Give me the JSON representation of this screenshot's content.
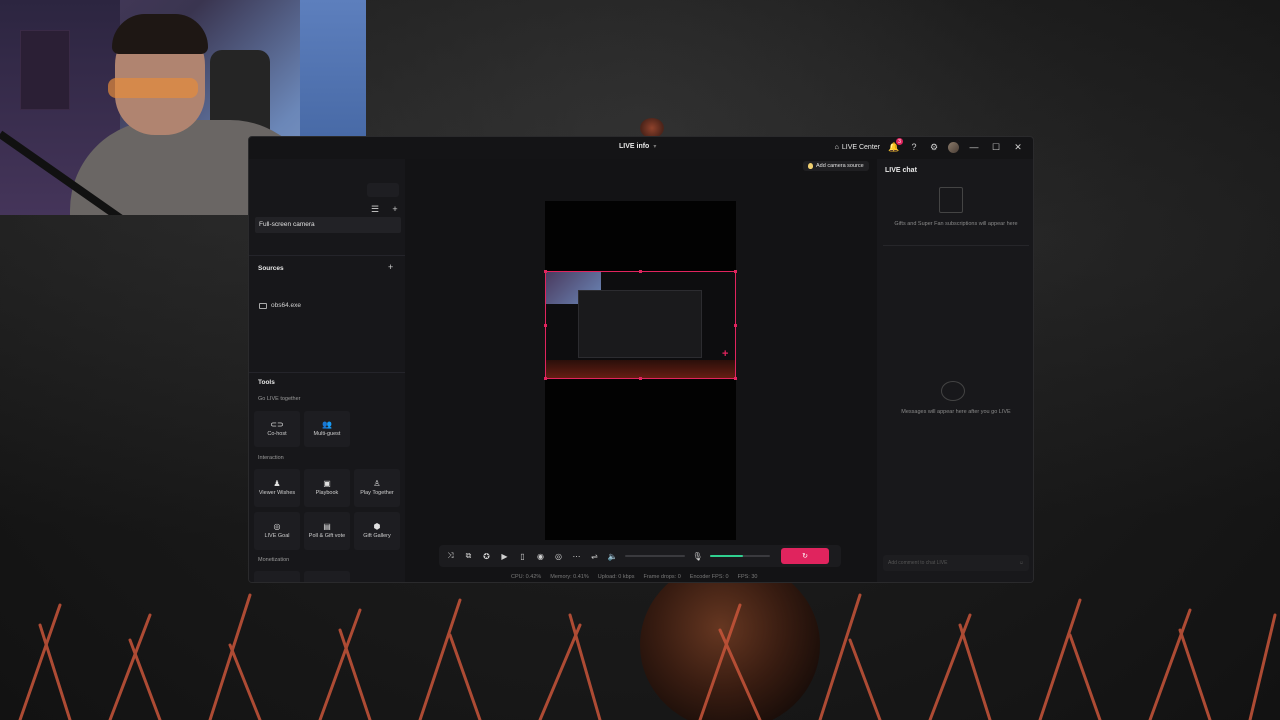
{
  "window": {
    "title": "LIVE info",
    "live_center_label": "LIVE Center",
    "notification_count": "3"
  },
  "scenes": {
    "selected_scene": "Full-screen camera"
  },
  "sources": {
    "title": "Sources",
    "items": [
      {
        "label": "obs64.exe"
      }
    ]
  },
  "tools": {
    "title": "Tools",
    "go_live_together": {
      "label": "Go LIVE together",
      "items": [
        {
          "label": "Co-host",
          "icon": "link-icon"
        },
        {
          "label": "Multi-guest",
          "icon": "users-icon"
        }
      ]
    },
    "interaction": {
      "label": "Interaction",
      "items": [
        {
          "label": "Viewer Wishes",
          "icon": "wish-icon"
        },
        {
          "label": "Playbook",
          "icon": "playbook-icon"
        },
        {
          "label": "Play Together",
          "icon": "play-together-icon"
        },
        {
          "label": "LIVE Goal",
          "icon": "goal-icon"
        },
        {
          "label": "Poll & Gift vote",
          "icon": "poll-icon"
        },
        {
          "label": "Gift Gallery",
          "icon": "gift-gallery-icon"
        }
      ]
    },
    "monetization": {
      "label": "Monetization"
    }
  },
  "preview": {
    "add_camera_label": "Add camera source"
  },
  "stats": {
    "cpu": "CPU: 0.42%",
    "memory": "Memory: 0.41%",
    "upload": "Upload: 0 kbps",
    "frame_drops": "Frame drops: 0",
    "encoder_fps": "Encoder FPS: 0",
    "fps": "FPS: 30"
  },
  "audio": {
    "mic_level": 0.55
  },
  "chat": {
    "title": "LIVE chat",
    "gifts_message": "Gifts and Super Fan subscriptions will appear here",
    "messages_placeholder": "Messages will appear here after you go LIVE",
    "input_placeholder": "Add comment to chat LIVE"
  },
  "colors": {
    "accent": "#e0245e",
    "mic_green": "#30d090"
  }
}
